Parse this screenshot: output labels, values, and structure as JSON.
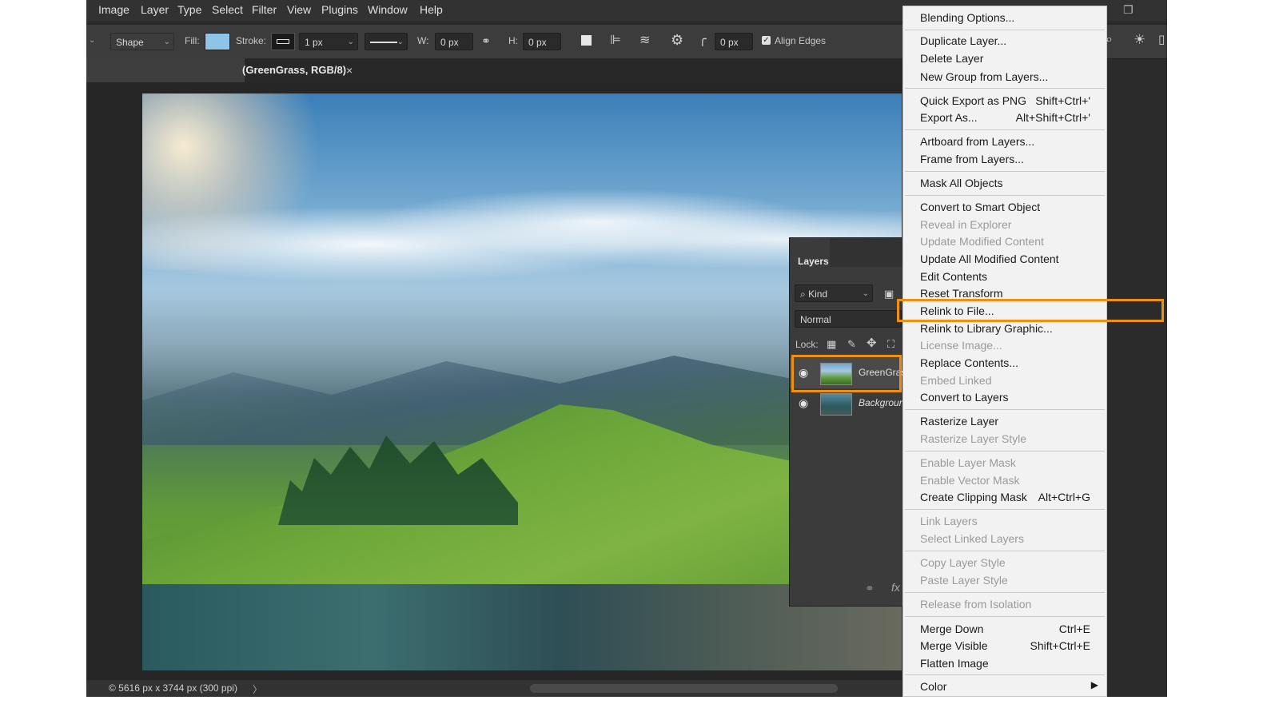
{
  "menubar": {
    "items": [
      "Image",
      "Layer",
      "Type",
      "Select",
      "Filter",
      "View",
      "Plugins",
      "Window",
      "Help"
    ]
  },
  "options": {
    "tool_mode": "Shape",
    "fill_label": "Fill:",
    "fill_color": "#8fc3e8",
    "stroke_label": "Stroke:",
    "stroke_width": "1 px",
    "w_label": "W:",
    "w_value": "0 px",
    "h_label": "H:",
    "h_value": "0 px",
    "radius_value": "0 px",
    "align_edges_label": "Align Edges",
    "align_edges_checked": true
  },
  "document": {
    "tab_label": "(GreenGrass, RGB/8)",
    "close_glyph": "×",
    "status": "© 5616 px x 3744 px (300 ppi)",
    "status_arrow": "〉"
  },
  "layers_panel": {
    "title": "Layers",
    "filter_kind": "Kind",
    "blend_mode": "Normal",
    "lock_label": "Lock:",
    "layers": [
      {
        "name": "GreenGrass",
        "visible": true,
        "selected": true
      },
      {
        "name": "Background",
        "visible": true,
        "selected": false
      }
    ],
    "footer_fx": "fx"
  },
  "context_menu": {
    "items": [
      {
        "label": "Blending Options...",
        "shortcut": "",
        "enabled": true
      },
      {
        "label": "Duplicate Layer...",
        "shortcut": "",
        "enabled": true
      },
      {
        "label": "Delete Layer",
        "shortcut": "",
        "enabled": true
      },
      {
        "label": "New Group from Layers...",
        "shortcut": "",
        "enabled": true
      },
      {
        "label": "Quick Export as PNG",
        "shortcut": "Shift+Ctrl+'",
        "enabled": true
      },
      {
        "label": "Export As...",
        "shortcut": "Alt+Shift+Ctrl+'",
        "enabled": true
      },
      {
        "label": "Artboard from Layers...",
        "shortcut": "",
        "enabled": true
      },
      {
        "label": "Frame from Layers...",
        "shortcut": "",
        "enabled": true
      },
      {
        "label": "Mask All Objects",
        "shortcut": "",
        "enabled": true
      },
      {
        "label": "Convert to Smart Object",
        "shortcut": "",
        "enabled": true
      },
      {
        "label": "Reveal in Explorer",
        "shortcut": "",
        "enabled": false
      },
      {
        "label": "Update Modified Content",
        "shortcut": "",
        "enabled": false
      },
      {
        "label": "Update All Modified Content",
        "shortcut": "",
        "enabled": true
      },
      {
        "label": "Edit Contents",
        "shortcut": "",
        "enabled": true
      },
      {
        "label": "Reset Transform",
        "shortcut": "",
        "enabled": true
      },
      {
        "label": "Relink to File...",
        "shortcut": "",
        "enabled": true,
        "highlighted": true
      },
      {
        "label": "Relink to Library Graphic...",
        "shortcut": "",
        "enabled": true
      },
      {
        "label": "License Image...",
        "shortcut": "",
        "enabled": false
      },
      {
        "label": "Replace Contents...",
        "shortcut": "",
        "enabled": true
      },
      {
        "label": "Embed Linked",
        "shortcut": "",
        "enabled": false
      },
      {
        "label": "Convert to Layers",
        "shortcut": "",
        "enabled": true
      },
      {
        "label": "Rasterize Layer",
        "shortcut": "",
        "enabled": true
      },
      {
        "label": "Rasterize Layer Style",
        "shortcut": "",
        "enabled": false
      },
      {
        "label": "Enable Layer Mask",
        "shortcut": "",
        "enabled": false
      },
      {
        "label": "Enable Vector Mask",
        "shortcut": "",
        "enabled": false
      },
      {
        "label": "Create Clipping Mask",
        "shortcut": "Alt+Ctrl+G",
        "enabled": true
      },
      {
        "label": "Link Layers",
        "shortcut": "",
        "enabled": false
      },
      {
        "label": "Select Linked Layers",
        "shortcut": "",
        "enabled": false
      },
      {
        "label": "Copy Layer Style",
        "shortcut": "",
        "enabled": false
      },
      {
        "label": "Paste Layer Style",
        "shortcut": "",
        "enabled": false
      },
      {
        "label": "Release from Isolation",
        "shortcut": "",
        "enabled": false
      },
      {
        "label": "Merge Down",
        "shortcut": "Ctrl+E",
        "enabled": true
      },
      {
        "label": "Merge Visible",
        "shortcut": "Shift+Ctrl+E",
        "enabled": true
      },
      {
        "label": "Flatten Image",
        "shortcut": "",
        "enabled": true
      },
      {
        "label": "Color",
        "shortcut": "",
        "enabled": true,
        "submenu": true
      }
    ]
  },
  "colors": {
    "highlight": "#f0900c",
    "menu_bg": "#f2f2f2",
    "app_bg": "#2b2b2b"
  }
}
